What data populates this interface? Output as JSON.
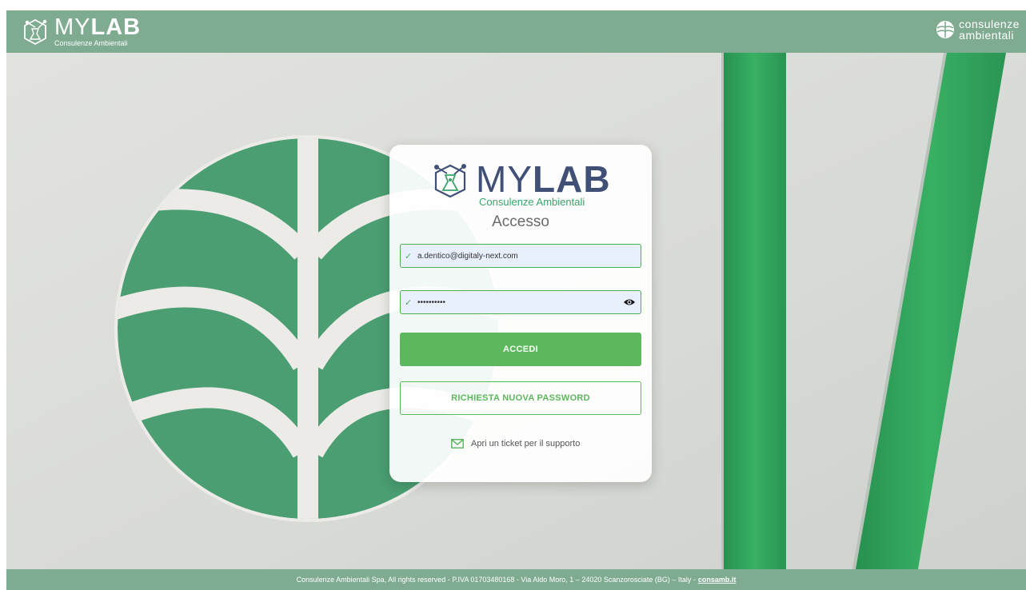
{
  "header": {
    "brand_thin": "MY",
    "brand_bold": "LAB",
    "brand_subtitle": "Consulenze Ambientali",
    "partner_line1": "consulenze",
    "partner_line2": "ambientali"
  },
  "login": {
    "logo_thin": "MY",
    "logo_bold": "LAB",
    "logo_subtitle": "Consulenze Ambientali",
    "title": "Accesso",
    "email_value": "a.dentico@digitaly-next.com",
    "password_value": "••••••••••",
    "submit_label": "ACCEDI",
    "reset_label": "RICHIESTA NUOVA PASSWORD",
    "support_label": "Apri un ticket per il supporto"
  },
  "footer": {
    "text": "Consulenze Ambientali Spa, All rights reserved - P.IVA 01703480168 - Via Aldo Moro, 1 – 24020 Scanzorosciate (BG) – Italy -",
    "link_label": "consamb.it"
  },
  "colors": {
    "header_green": "#7fab91",
    "primary_green": "#5cb85c",
    "logo_navy": "#3f4f76",
    "logo_green": "#3aa36a"
  }
}
